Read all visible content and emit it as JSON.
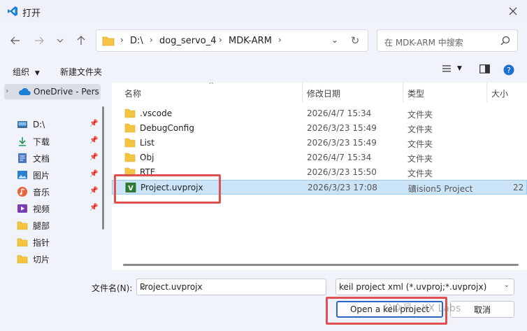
{
  "window": {
    "title": "打开"
  },
  "address": {
    "crumbs": [
      "D:\\",
      "dog_servo_4",
      "MDK-ARM"
    ]
  },
  "search": {
    "placeholder": "在 MDK-ARM 中搜索"
  },
  "toolbar": {
    "organize": "组织",
    "new_folder": "新建文件夹"
  },
  "sidebar": {
    "onedrive": "OneDrive - Pers",
    "items": [
      {
        "label": "D:\\",
        "icon": "drive-icon",
        "pinned": true
      },
      {
        "label": "下载",
        "icon": "download-icon",
        "pinned": true
      },
      {
        "label": "文档",
        "icon": "document-icon",
        "pinned": true
      },
      {
        "label": "图片",
        "icon": "picture-icon",
        "pinned": true
      },
      {
        "label": "音乐",
        "icon": "music-icon",
        "pinned": true
      },
      {
        "label": "视频",
        "icon": "video-icon",
        "pinned": true
      },
      {
        "label": "腿部",
        "icon": "folder-icon",
        "pinned": false
      },
      {
        "label": "指针",
        "icon": "folder-icon",
        "pinned": false
      },
      {
        "label": "切片",
        "icon": "folder-icon",
        "pinned": false
      }
    ]
  },
  "columns": {
    "name": "名称",
    "date": "修改日期",
    "type": "类型",
    "size": "大小"
  },
  "files": [
    {
      "name": ".vscode",
      "date": "2026/4/7 15:34",
      "type": "文件夹",
      "size": "",
      "kind": "folder"
    },
    {
      "name": "DebugConfig",
      "date": "2026/3/23 15:49",
      "type": "文件夹",
      "size": "",
      "kind": "folder"
    },
    {
      "name": "List",
      "date": "2026/3/23 15:49",
      "type": "文件夹",
      "size": "",
      "kind": "folder"
    },
    {
      "name": "Obj",
      "date": "2026/4/7 15:34",
      "type": "文件夹",
      "size": "",
      "kind": "folder"
    },
    {
      "name": "RTE",
      "date": "2026/3/23 15:50",
      "type": "文件夹",
      "size": "",
      "kind": "folder"
    },
    {
      "name": "Project.uvprojx",
      "date": "2026/3/23 17:08",
      "type": "礦ision5 Project",
      "size": "22",
      "kind": "uvproj",
      "selected": true
    }
  ],
  "footer": {
    "filename_label": "文件名(N):",
    "filename_value": "Project.uvprojx",
    "filter_value": "keil project xml (*.uvproj;*.uvprojx)",
    "open_button": "Open a keil project",
    "cancel_button": "取消",
    "watermark": "公众号 · KX Labs"
  },
  "colors": {
    "accent": "#2b66c4",
    "selection": "#cce4f7",
    "highlight_box": "#e05050",
    "folder": "#f4c542"
  }
}
